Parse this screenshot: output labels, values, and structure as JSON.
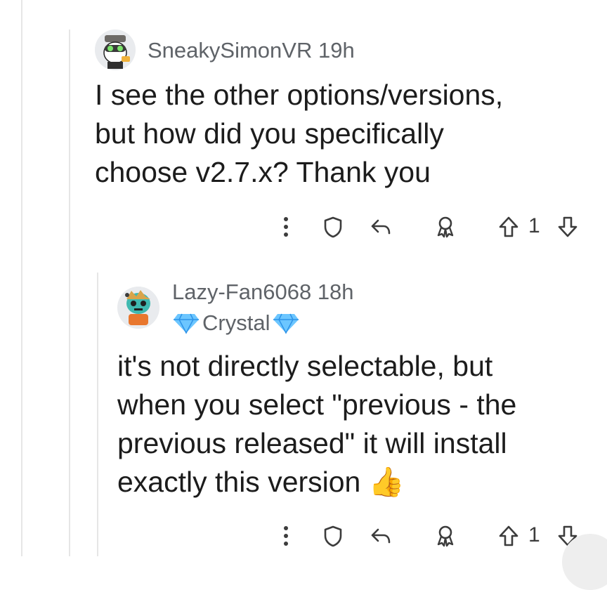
{
  "comments": [
    {
      "username": "SneakySimonVR",
      "time": "19h",
      "body_lines": [
        "I see the other options/versions,",
        "but how did you specifically",
        "choose v2.7.x? Thank you"
      ],
      "votes": "1"
    },
    {
      "username": "Lazy-Fan6068",
      "time": "18h",
      "flair": "Crystal",
      "body_lines": [
        "it's not directly selectable, but",
        "when you select \"previous - the",
        "previous released\" it will install",
        "exactly this version"
      ],
      "emoji": "👍",
      "votes": "1"
    }
  ],
  "icons": {
    "more": "more-options-icon",
    "shield": "shield-icon",
    "reply": "reply-icon",
    "award": "award-icon",
    "upvote": "upvote-icon",
    "downvote": "downvote-icon"
  },
  "colors": {
    "thread_line": "#e6e6e6",
    "meta_text": "#5f6368",
    "body_text": "#1c1c1c",
    "diamond": "#4fb6ff"
  }
}
